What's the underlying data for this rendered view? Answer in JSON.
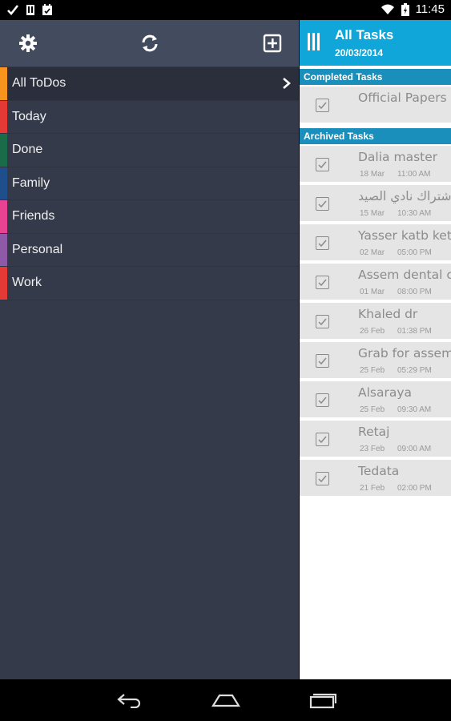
{
  "status_bar": {
    "time": "11:45",
    "icons": [
      "check-icon",
      "sim-card-icon",
      "calendar-icon",
      "wifi-icon",
      "battery-icon"
    ]
  },
  "drawer": {
    "toolbar": {
      "icons": [
        "gear-icon",
        "sync-icon",
        "add-box-icon"
      ]
    },
    "categories": [
      {
        "label": "All ToDos",
        "color": "#f7941e",
        "active": true
      },
      {
        "label": "Today",
        "color": "#e53935"
      },
      {
        "label": "Done",
        "color": "#1a6b4a"
      },
      {
        "label": "Family",
        "color": "#1e4f8c"
      },
      {
        "label": "Friends",
        "color": "#e84393"
      },
      {
        "label": "Personal",
        "color": "#8e5aa8"
      },
      {
        "label": "Work",
        "color": "#e53935"
      }
    ]
  },
  "panel": {
    "title": "All Tasks",
    "date": "20/03/2014",
    "completed_header": "Completed Tasks",
    "archived_header": "Archived Tasks",
    "completed_tasks": [
      {
        "title": "Official Papers",
        "date": "",
        "time": ""
      }
    ],
    "archived_tasks": [
      {
        "title": "Dalia master",
        "date": "18 Mar",
        "time": "11:00 AM"
      },
      {
        "title": "اشتراك نادي الصيد",
        "date": "15 Mar",
        "time": "10:30 AM"
      },
      {
        "title": "Yasser katb ket",
        "date": "02 Mar",
        "time": "05:00 PM"
      },
      {
        "title": "Assem dental c",
        "date": "01 Mar",
        "time": "08:00 PM"
      },
      {
        "title": "Khaled dr",
        "date": "26 Feb",
        "time": "01:38 PM"
      },
      {
        "title": "Grab for assem",
        "date": "25 Feb",
        "time": "05:29 PM"
      },
      {
        "title": "Alsaraya",
        "date": "25 Feb",
        "time": "09:30 AM"
      },
      {
        "title": "Retaj",
        "date": "23 Feb",
        "time": "09:00 AM"
      },
      {
        "title": "Tedata",
        "date": "21 Feb",
        "time": "02:00 PM"
      }
    ]
  },
  "nav_bar": {
    "icons": [
      "back-icon",
      "home-icon",
      "recents-icon"
    ]
  },
  "colors": {
    "header_blue": "#11a6d9",
    "section_blue": "#1a8fbb",
    "drawer_bg": "#343a49",
    "drawer_toolbar": "#434b5e"
  }
}
